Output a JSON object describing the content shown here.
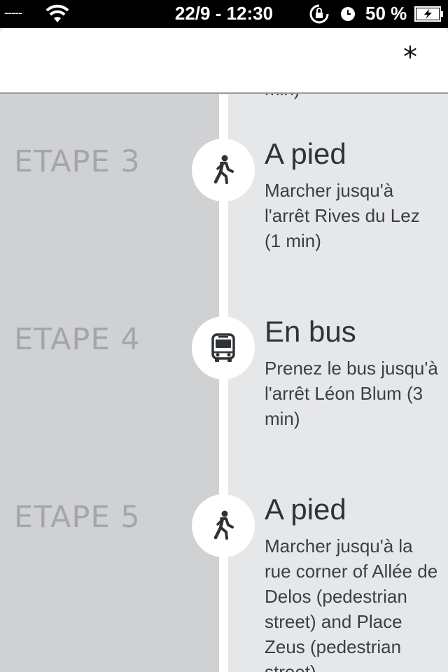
{
  "status_bar": {
    "carrier": "-----",
    "datetime": "22/9 - 12:30",
    "battery_percent": "50 %",
    "icons": [
      "wifi-icon",
      "rotation-lock-icon",
      "alarm-clock-icon",
      "battery-charging-icon"
    ]
  },
  "nav": {
    "action_symbol": "*",
    "action_icon": "asterisk-icon"
  },
  "previous_step_cut_text": "min)",
  "steps": [
    {
      "label": "ETAPE 3",
      "icon": "walking-person-icon",
      "title": "A pied",
      "description": "Marcher jusqu'à l'arrêt Rives du Lez (1 min)"
    },
    {
      "label": "ETAPE 4",
      "icon": "bus-icon",
      "title": "En bus",
      "description": "Prenez le bus jusqu'à l'arrêt Léon Blum (3 min)"
    },
    {
      "label": "ETAPE 5",
      "icon": "walking-person-icon",
      "title": "A pied",
      "description": "Marcher jusqu'à la rue corner of Allée de Delos (pedestrian street) and Place Zeus (pedestrian street)"
    }
  ],
  "colors": {
    "left_column": "#d0d1d3",
    "right_column": "#e6e7e9",
    "spine": "#ffffff",
    "label_gray": "#a4a6a9",
    "text_dark": "#2f3338"
  }
}
